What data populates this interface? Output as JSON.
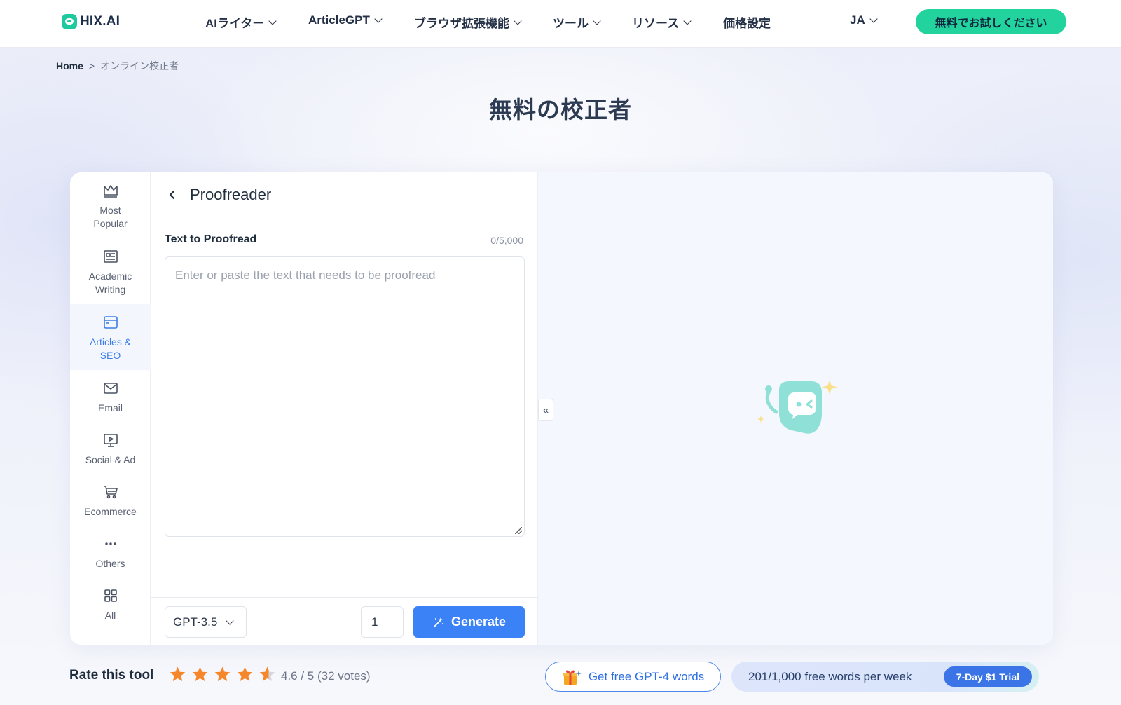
{
  "nav": {
    "logo": "HIX.AI",
    "items": [
      {
        "label": "AIライター"
      },
      {
        "label": "ArticleGPT"
      },
      {
        "label": "ブラウザ拡張機能"
      },
      {
        "label": "ツール"
      },
      {
        "label": "リソース"
      },
      {
        "label": "価格設定"
      }
    ],
    "language": "JA",
    "cta": "無料でお試しください"
  },
  "breadcrumb": {
    "home": "Home",
    "separator": ">",
    "current": "オンライン校正者"
  },
  "page_title": "無料の校正者",
  "sidebar": {
    "items": [
      {
        "label": "Most Popular",
        "icon": "crown-icon",
        "active": false
      },
      {
        "label": "Academic Writing",
        "icon": "newspaper-icon",
        "active": false
      },
      {
        "label": "Articles & SEO",
        "icon": "browser-window-icon",
        "active": true
      },
      {
        "label": "Email",
        "icon": "mail-icon",
        "active": false
      },
      {
        "label": "Social & Ad",
        "icon": "monitor-play-icon",
        "active": false
      },
      {
        "label": "Ecommerce",
        "icon": "cart-icon",
        "active": false
      },
      {
        "label": "Others",
        "icon": "more-dots-icon",
        "active": false
      },
      {
        "label": "All",
        "icon": "grid-icon",
        "active": false
      }
    ]
  },
  "tool": {
    "title": "Proofreader",
    "field_label": "Text to Proofread",
    "char_count": "0/5,000",
    "placeholder": "Enter or paste the text that needs to be proofread",
    "model": "GPT-3.5",
    "quantity": "1",
    "generate_label": "Generate"
  },
  "output": {
    "collapse_glyph": "«"
  },
  "rating": {
    "label": "Rate this tool",
    "score_text": "4.6 / 5 (32 votes)",
    "stars": 4.6,
    "star_color": "#f5872a"
  },
  "promo": {
    "gpt4_label": "Get free GPT-4 words",
    "words_label": "201/1,000 free words per week",
    "trial_label": "7-Day $1 Trial"
  },
  "colors": {
    "accent_green": "#22d39d",
    "primary_blue": "#3b82f6",
    "robot_teal": "#8fe0d6",
    "sparkle_yellow": "#f8e08a"
  }
}
